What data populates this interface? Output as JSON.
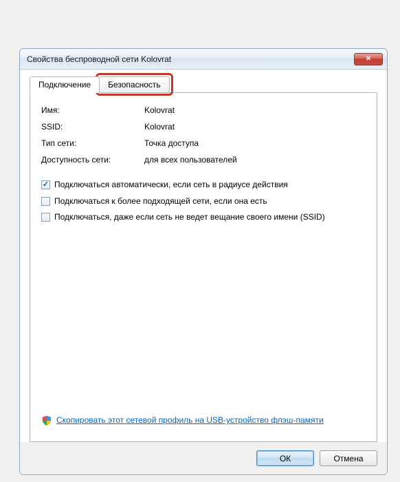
{
  "titlebar": {
    "title": "Свойства беспроводной сети Kolovrat"
  },
  "tabs": {
    "connection": "Подключение",
    "security": "Безопасность"
  },
  "info": {
    "name_label": "Имя:",
    "name_value": "Kolovrat",
    "ssid_label": "SSID:",
    "ssid_value": "Kolovrat",
    "type_label": "Тип сети:",
    "type_value": "Точка доступа",
    "avail_label": "Доступность сети:",
    "avail_value": "для всех пользователей"
  },
  "checkboxes": {
    "auto": "Подключаться автоматически, если сеть в радиусе действия",
    "preferred": "Подключаться к более подходящей сети, если она есть",
    "hidden": "Подключаться, даже если сеть не ведет вещание своего имени (SSID)"
  },
  "link": {
    "text": "Скопировать этот сетевой профиль на USB-устройство флэш-памяти"
  },
  "buttons": {
    "ok": "ОК",
    "cancel": "Отмена"
  }
}
